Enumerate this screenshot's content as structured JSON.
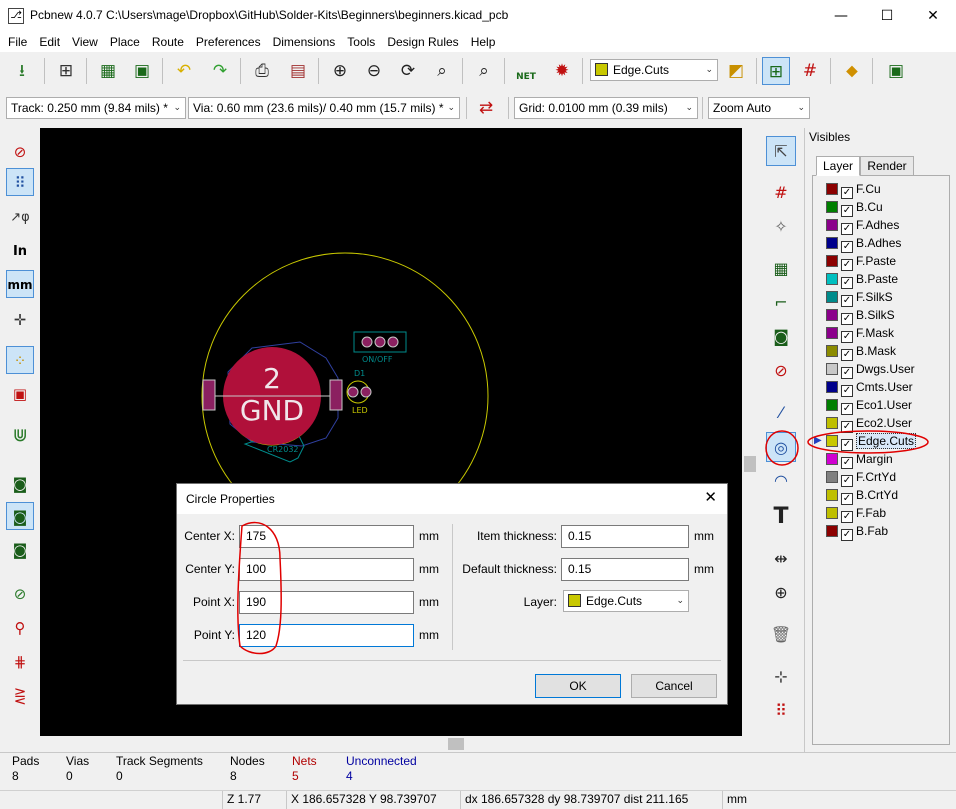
{
  "window": {
    "title": "Pcbnew 4.0.7 C:\\Users\\mage\\Dropbox\\GitHub\\Solder-Kits\\Beginners\\beginners.kicad_pcb",
    "min": "—",
    "max": "☐",
    "close": "✕"
  },
  "menu": [
    "File",
    "Edit",
    "View",
    "Place",
    "Route",
    "Preferences",
    "Dimensions",
    "Tools",
    "Design Rules",
    "Help"
  ],
  "toolbar": {
    "layer_select": "Edge.Cuts",
    "net_label": "NET"
  },
  "toolbar2": {
    "track": "Track: 0.250 mm (9.84 mils) *",
    "via": "Via: 0.60 mm (23.6 mils)/ 0.40 mm (15.7 mils) *",
    "grid": "Grid: 0.0100 mm (0.39 mils)",
    "zoom": "Zoom Auto"
  },
  "left_tools": {
    "in_label": "In",
    "mm_label": "mm"
  },
  "canvas": {
    "pad_number": "2",
    "pad_net": "GND",
    "switch_label": "ON/OFF",
    "led_ref": "D1",
    "led_label": "LED",
    "battery_label": "CR2032"
  },
  "visibles": {
    "title": "Visibles",
    "tabs": [
      "Layer",
      "Render"
    ],
    "layers": [
      {
        "name": "F.Cu",
        "color": "#8b0000"
      },
      {
        "name": "B.Cu",
        "color": "#007f00"
      },
      {
        "name": "F.Adhes",
        "color": "#8b008b"
      },
      {
        "name": "B.Adhes",
        "color": "#00008b"
      },
      {
        "name": "F.Paste",
        "color": "#8b0000"
      },
      {
        "name": "B.Paste",
        "color": "#00bfbf"
      },
      {
        "name": "F.SilkS",
        "color": "#008b8b"
      },
      {
        "name": "B.SilkS",
        "color": "#8b008b"
      },
      {
        "name": "F.Mask",
        "color": "#8b008b"
      },
      {
        "name": "B.Mask",
        "color": "#8b8b00"
      },
      {
        "name": "Dwgs.User",
        "color": "#c8c8c8"
      },
      {
        "name": "Cmts.User",
        "color": "#00008b"
      },
      {
        "name": "Eco1.User",
        "color": "#007f00"
      },
      {
        "name": "Eco2.User",
        "color": "#bfbf00"
      },
      {
        "name": "Edge.Cuts",
        "color": "#c8c800"
      },
      {
        "name": "Margin",
        "color": "#d000d0"
      },
      {
        "name": "F.CrtYd",
        "color": "#808080"
      },
      {
        "name": "B.CrtYd",
        "color": "#bfbf00"
      },
      {
        "name": "F.Fab",
        "color": "#bfbf00"
      },
      {
        "name": "B.Fab",
        "color": "#8b0000"
      }
    ],
    "active_layer": "Edge.Cuts"
  },
  "status": {
    "headers": [
      "Pads",
      "Vias",
      "Track Segments",
      "Nodes",
      "Nets",
      "Unconnected"
    ],
    "values": [
      "8",
      "0",
      "0",
      "8",
      "5",
      "4"
    ],
    "zoom": "Z 1.77",
    "xy": "X 186.657328  Y 98.739707",
    "delta": "dx 186.657328  dy 98.739707  dist 211.165",
    "units": "mm"
  },
  "dialog": {
    "title": "Circle Properties",
    "center_x_label": "Center X:",
    "center_x": "175",
    "center_y_label": "Center Y:",
    "center_y": "100",
    "point_x_label": "Point X:",
    "point_x": "190",
    "point_y_label": "Point Y:",
    "point_y": "120",
    "unit": "mm",
    "item_thickness_label": "Item thickness:",
    "item_thickness": "0.15",
    "default_thickness_label": "Default thickness:",
    "default_thickness": "0.15",
    "layer_label": "Layer:",
    "layer": "Edge.Cuts",
    "ok": "OK",
    "cancel": "Cancel"
  },
  "colors": {
    "annotation": "#e00000",
    "edge_cuts": "#c8c800",
    "pad": "#b0103a",
    "selection_blue": "#cce4f7"
  }
}
